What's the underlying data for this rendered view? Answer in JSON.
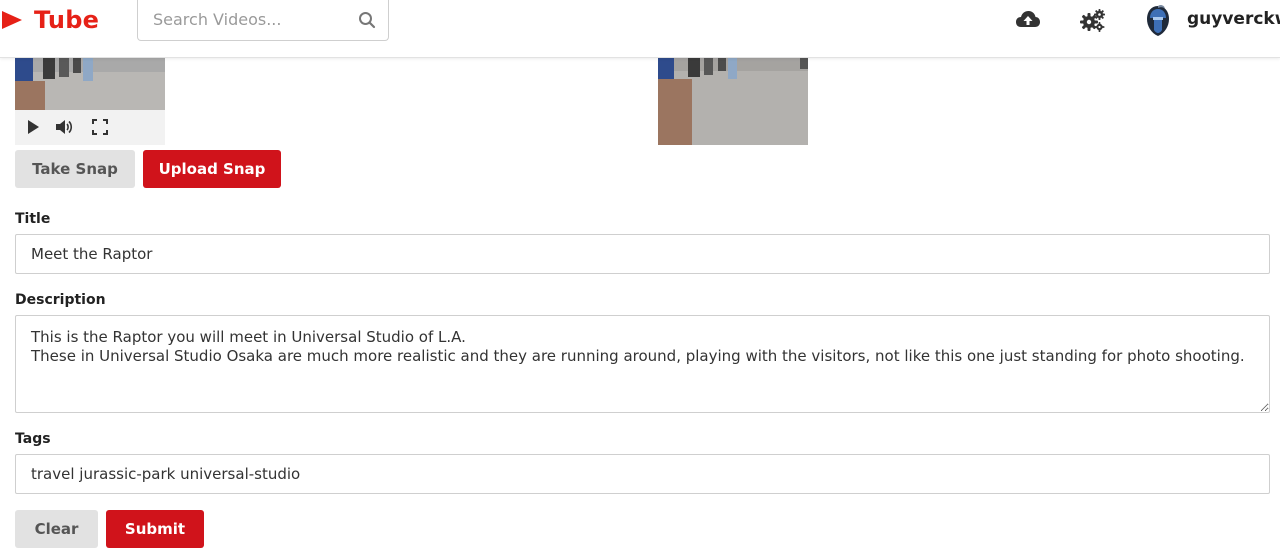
{
  "header": {
    "brand": "Tube",
    "search_placeholder": "Search Videos...",
    "username": "guyverckw",
    "icons": [
      "play-logo-icon",
      "search-icon",
      "cloud-upload-icon",
      "gears-icon",
      "avatar"
    ]
  },
  "snapshot": {
    "take_snap_label": "Take Snap",
    "upload_snap_label": "Upload Snap"
  },
  "form": {
    "title_label": "Title",
    "title_value": "Meet the Raptor",
    "description_label": "Description",
    "description_value": "This is the Raptor you will meet in Universal Studio of L.A.\nThese in Universal Studio Osaka are much more realistic and they are running around, playing with the visitors, not like this one just standing for photo shooting.",
    "tags_label": "Tags",
    "tags_value": "travel jurassic-park universal-studio",
    "clear_label": "Clear",
    "submit_label": "Submit"
  },
  "colors": {
    "accent": "#d0131b",
    "brand": "#e62117",
    "secondary_button": "#e2e2e2"
  }
}
